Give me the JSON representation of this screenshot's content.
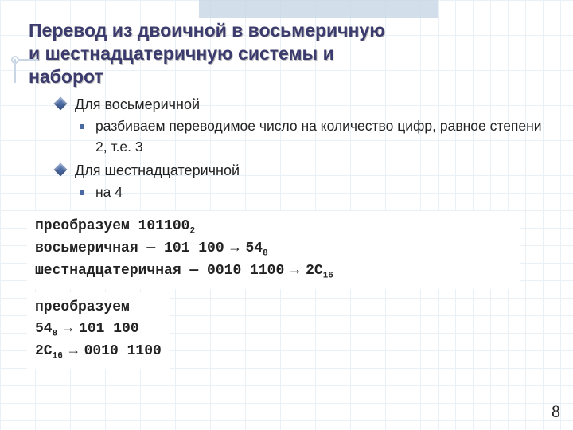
{
  "page_number": "8",
  "title_lines": [
    "Перевод из двоичной в восьмеричную",
    "и шестнадцатеричную системы и",
    "наборот"
  ],
  "bullets": {
    "octal_head": "Для восьмеричной",
    "octal_rule": "разбиваем переводимое число на количество цифр, равное степени 2, т.е. 3",
    "hex_head": "Для шестнадцатеричной",
    "hex_rule": "на 4"
  },
  "example1": {
    "line1_prefix": "преобразуем ",
    "line1_num": "101100",
    "line1_sub": "2",
    "line2_label": "восьмеричная — ",
    "line2_groups": "101 100",
    "line2_result": "54",
    "line2_sub": "8",
    "line3_label": "шестнадцатеричная — ",
    "line3_groups": "0010 1100",
    "line3_result": "2C",
    "line3_sub": "16"
  },
  "example2": {
    "line1_prefix": "преобразуем",
    "line2_num": "54",
    "line2_sub": "8",
    "line2_result": "101 100",
    "line3_num": "2C",
    "line3_sub": "16",
    "line3_result": "0010 1100"
  },
  "arrow_glyph": "→"
}
